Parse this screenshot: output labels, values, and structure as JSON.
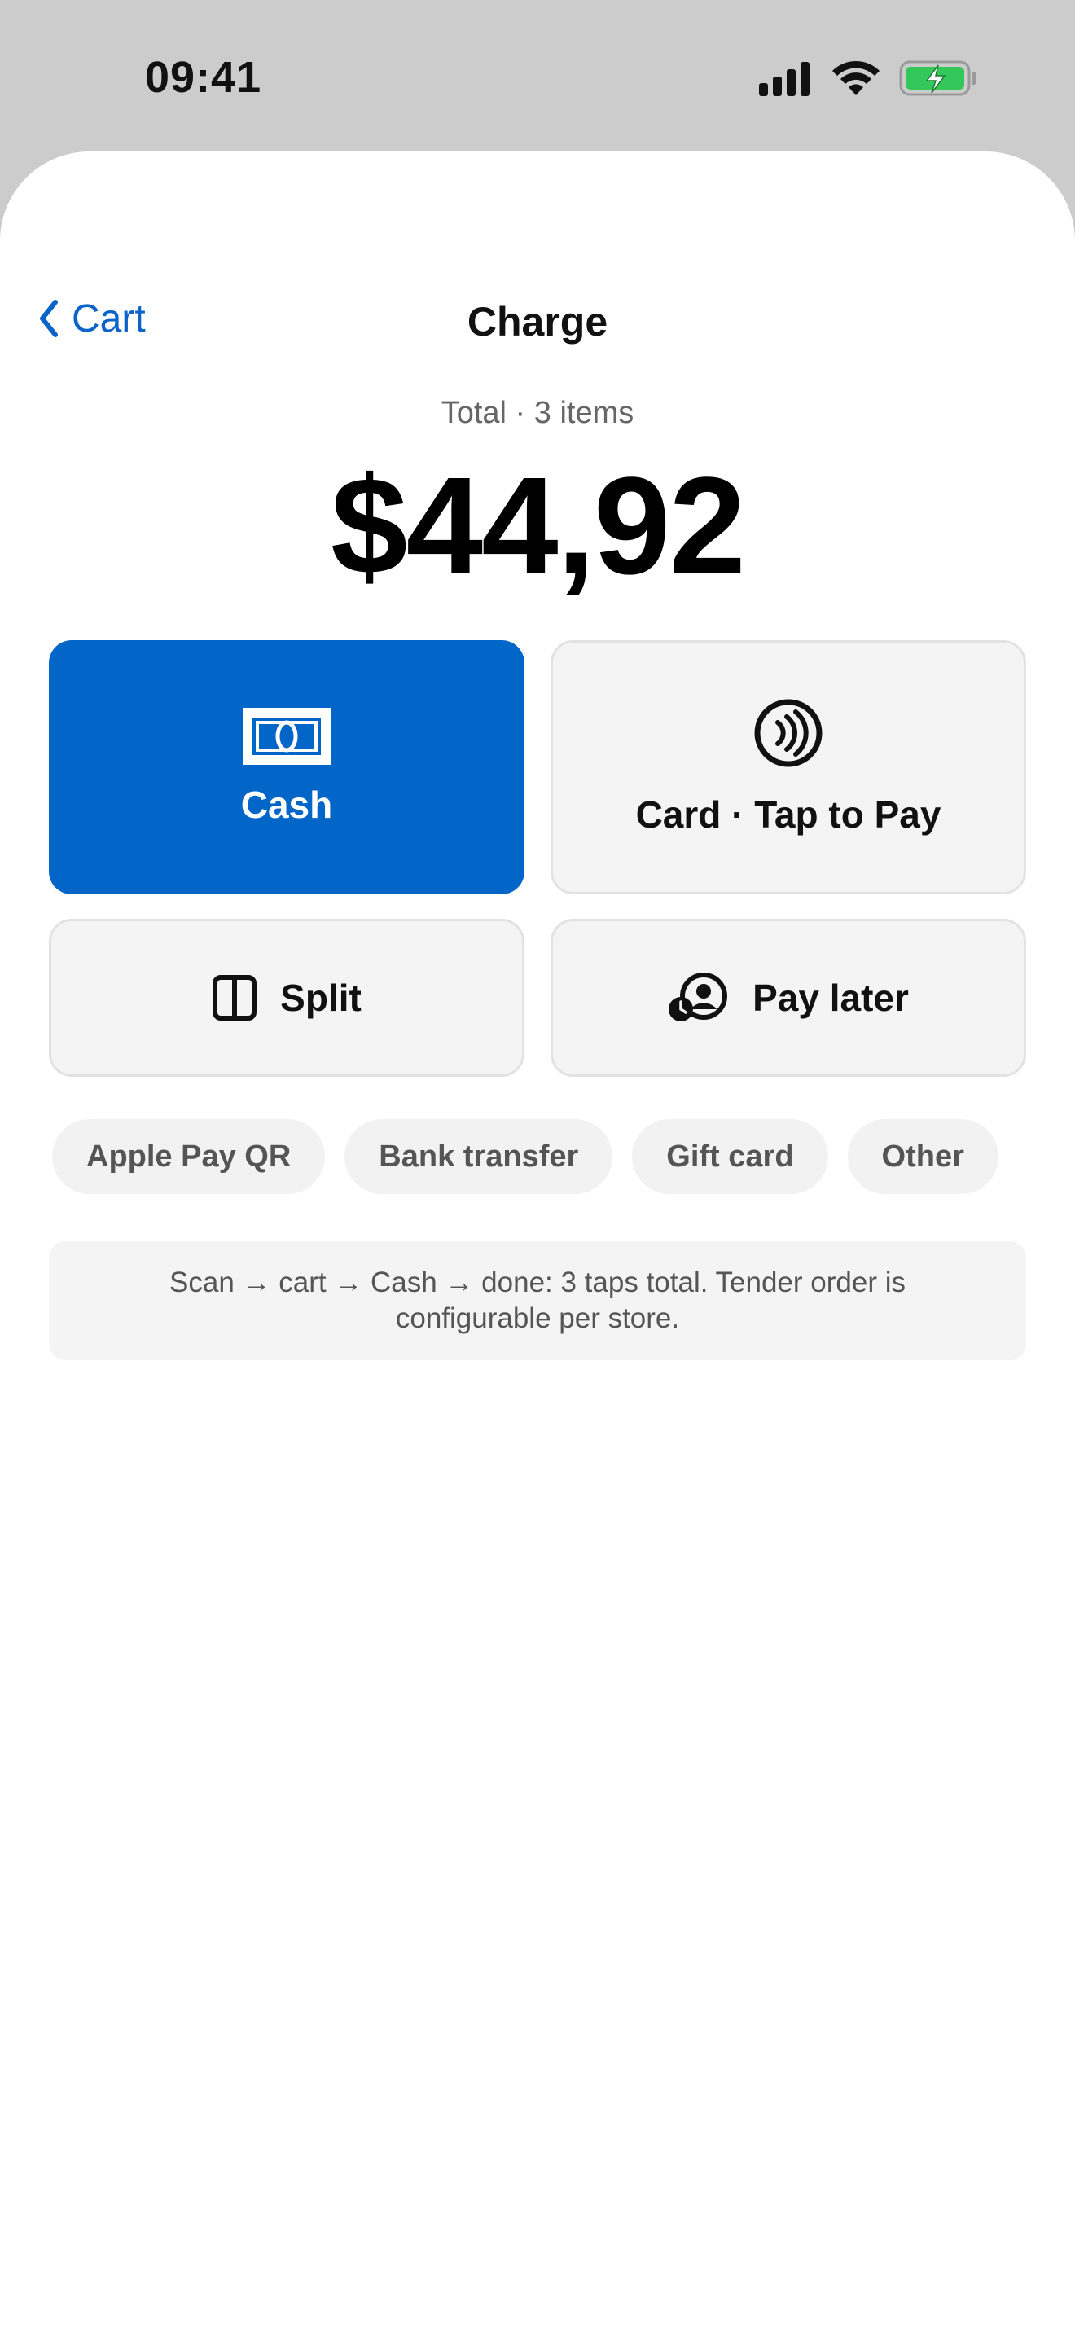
{
  "status_bar": {
    "time": "09:41"
  },
  "nav": {
    "back_label": "Cart",
    "title": "Charge"
  },
  "summary": {
    "subtitle": "Total · 3 items",
    "amount": "$44,92"
  },
  "tenders": {
    "cash": {
      "label": "Cash",
      "icon": "cash-icon"
    },
    "card": {
      "label": "Card · Tap to Pay",
      "icon": "contactless-icon"
    },
    "split": {
      "label": "Split",
      "icon": "split-icon"
    },
    "pay_later": {
      "label": "Pay later",
      "icon": "pay-later-icon"
    }
  },
  "other_methods": [
    "Apple Pay QR",
    "Bank transfer",
    "Gift card",
    "Other"
  ],
  "note": "Scan → cart → Cash → done: 3 taps total. Tender order is configurable per store.",
  "colors": {
    "accent": "#0266c9",
    "battery": "#34c759"
  }
}
